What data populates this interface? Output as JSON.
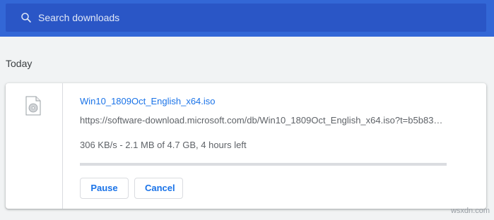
{
  "search": {
    "placeholder": "Search downloads",
    "icon": "search-icon"
  },
  "colors": {
    "header": "#3367d6",
    "search_bar": "#2a56c6",
    "link": "#1a73e8",
    "page_bg": "#f1f3f4"
  },
  "section": {
    "title": "Today"
  },
  "download": {
    "file_name": "Win10_1809Oct_English_x64.iso",
    "url": "https://software-download.microsoft.com/db/Win10_1809Oct_English_x64.iso?t=b5b83…",
    "status": "306 KB/s - 2.1 MB of 4.7 GB, 4 hours left",
    "progress_fraction": 0.0,
    "icon": "file-icon",
    "buttons": {
      "pause": "Pause",
      "cancel": "Cancel"
    }
  },
  "watermark": "wsxdn.com"
}
